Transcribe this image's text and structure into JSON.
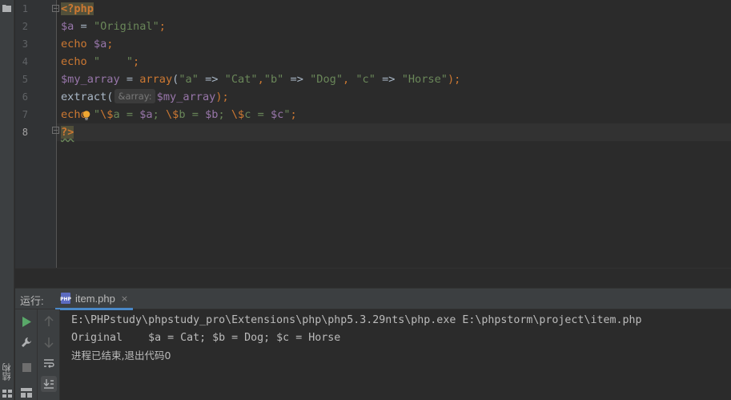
{
  "sidebar": {
    "structure_tab_label": "结构"
  },
  "editor": {
    "line_numbers": [
      "1",
      "2",
      "3",
      "4",
      "5",
      "6",
      "7",
      "8"
    ],
    "current_line": 8,
    "lines": [
      {
        "segments": [
          {
            "t": "<?php",
            "c": "tag"
          }
        ]
      },
      {
        "segments": [
          {
            "t": "$a",
            "c": "var"
          },
          {
            "t": " = ",
            "c": "op"
          },
          {
            "t": "\"Original\"",
            "c": "str"
          },
          {
            "t": ";",
            "c": "kw"
          }
        ]
      },
      {
        "segments": [
          {
            "t": "echo ",
            "c": "kw"
          },
          {
            "t": "$a",
            "c": "var"
          },
          {
            "t": ";",
            "c": "kw"
          }
        ]
      },
      {
        "segments": [
          {
            "t": "echo ",
            "c": "kw"
          },
          {
            "t": "\"    \"",
            "c": "str"
          },
          {
            "t": ";",
            "c": "kw"
          }
        ]
      },
      {
        "segments": [
          {
            "t": "$my_array",
            "c": "var"
          },
          {
            "t": " = ",
            "c": "op"
          },
          {
            "t": "array",
            "c": "fn"
          },
          {
            "t": "(",
            "c": "op"
          },
          {
            "t": "\"a\"",
            "c": "str"
          },
          {
            "t": " => ",
            "c": "op"
          },
          {
            "t": "\"Cat\"",
            "c": "str"
          },
          {
            "t": ",",
            "c": "kw"
          },
          {
            "t": "\"b\"",
            "c": "str"
          },
          {
            "t": " => ",
            "c": "op"
          },
          {
            "t": "\"Dog\"",
            "c": "str"
          },
          {
            "t": ", ",
            "c": "kw"
          },
          {
            "t": "\"c\"",
            "c": "str"
          },
          {
            "t": " => ",
            "c": "op"
          },
          {
            "t": "\"Horse\"",
            "c": "str"
          },
          {
            "t": ");",
            "c": "kw"
          }
        ]
      },
      {
        "segments": [
          {
            "t": "extract(",
            "c": "op"
          },
          {
            "t": "&array:",
            "c": "hint"
          },
          {
            "t": "$my_array",
            "c": "var"
          },
          {
            "t": ");",
            "c": "kw"
          }
        ]
      },
      {
        "segments": [
          {
            "t": "echo ",
            "c": "kw"
          },
          {
            "t": "\"",
            "c": "str"
          },
          {
            "t": "\\$",
            "c": "esc"
          },
          {
            "t": "a = ",
            "c": "str"
          },
          {
            "t": "$a",
            "c": "var"
          },
          {
            "t": "; ",
            "c": "str"
          },
          {
            "t": "\\$",
            "c": "esc"
          },
          {
            "t": "b = ",
            "c": "str"
          },
          {
            "t": "$b",
            "c": "var"
          },
          {
            "t": "; ",
            "c": "str"
          },
          {
            "t": "\\$",
            "c": "esc"
          },
          {
            "t": "c = ",
            "c": "str"
          },
          {
            "t": "$c",
            "c": "var"
          },
          {
            "t": "\"",
            "c": "str"
          },
          {
            "t": ";",
            "c": "kw"
          }
        ]
      },
      {
        "segments": [
          {
            "t": "?>",
            "c": "tag"
          }
        ]
      }
    ],
    "intention_icon": "lightbulb-icon"
  },
  "run_panel": {
    "label": "运行:",
    "tab_label": "item.php",
    "tab_close": "×",
    "tab_icon": "php-file-icon",
    "toolbar_left": [
      "rerun-icon",
      "wrench-icon",
      "stop-icon",
      "layout-icon"
    ],
    "toolbar_right": [
      "up-arrow-icon",
      "down-arrow-icon",
      "soft-wrap-icon",
      "scroll-to-end-icon"
    ],
    "console_lines": [
      "E:\\PHPstudy\\phpstudy_pro\\Extensions\\php\\php5.3.29nts\\php.exe E:\\phpstorm\\project\\item.php",
      "Original    $a = Cat; $b = Dog; $c = Horse",
      "进程已结束,退出代码0"
    ]
  },
  "colors": {
    "background": "#2b2b2b",
    "keyword": "#cc7832",
    "variable": "#9876aa",
    "string": "#6a8759",
    "text": "#a9b7c6",
    "run_icon": "#59a869",
    "tab_underline": "#4a88c7"
  }
}
